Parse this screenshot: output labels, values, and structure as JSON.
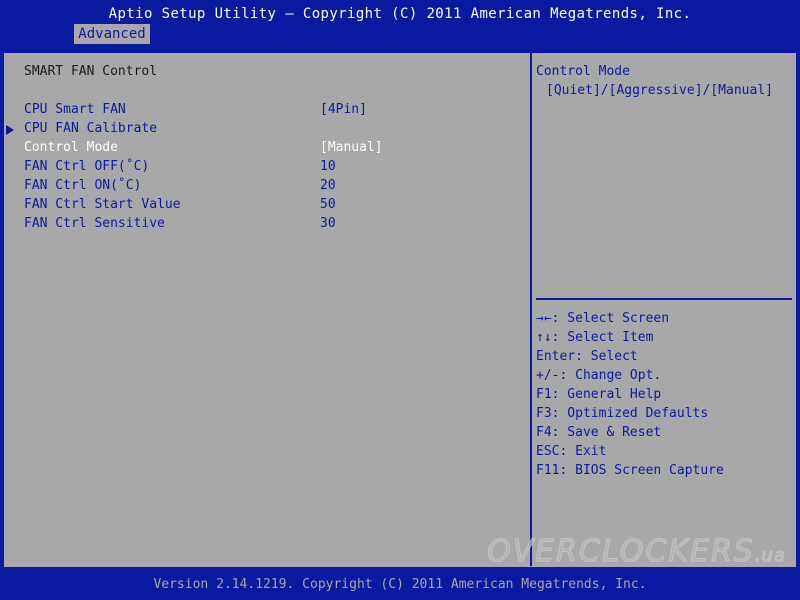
{
  "header": {
    "title": "Aptio Setup Utility – Copyright (C) 2011 American Megatrends, Inc.",
    "tabs": [
      {
        "label": "Advanced",
        "active": true
      }
    ]
  },
  "main": {
    "section_title": "SMART FAN Control",
    "items": [
      {
        "label": "CPU Smart FAN",
        "value": "[4Pin]",
        "submenu": false,
        "selected": false
      },
      {
        "label": "CPU FAN Calibrate",
        "value": "",
        "submenu": true,
        "selected": false
      },
      {
        "label": "Control Mode",
        "value": "[Manual]",
        "submenu": false,
        "selected": true
      },
      {
        "label": "FAN Ctrl OFF(˚C)",
        "value": "10",
        "submenu": false,
        "selected": false
      },
      {
        "label": "FAN Ctrl ON(˚C)",
        "value": "20",
        "submenu": false,
        "selected": false
      },
      {
        "label": "FAN Ctrl Start Value",
        "value": "50",
        "submenu": false,
        "selected": false
      },
      {
        "label": "FAN Ctrl Sensitive",
        "value": "30",
        "submenu": false,
        "selected": false
      }
    ]
  },
  "help": {
    "title": "Control Mode",
    "options": "[Quiet]/[Aggressive]/[Manual]"
  },
  "keys": [
    "→←: Select Screen",
    "↑↓: Select Item",
    "Enter: Select",
    "+/-: Change Opt.",
    "F1: General Help",
    "F3: Optimized Defaults",
    "F4: Save & Reset",
    "ESC: Exit",
    "F11: BIOS Screen Capture"
  ],
  "watermark": {
    "text": "OVERCLOCKERS",
    "suffix": ".ua"
  },
  "footer": {
    "version": "Version 2.14.1219. Copyright (C) 2011 American Megatrends, Inc."
  },
  "colors": {
    "background": "#0a1aa0",
    "panel": "#a8a8a8",
    "item_text": "#0a1aa0",
    "selected_text": "#ffffff"
  }
}
